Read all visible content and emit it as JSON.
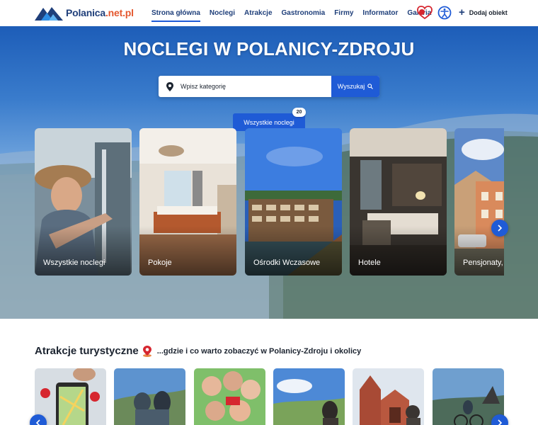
{
  "header": {
    "logo": {
      "name": "Polanica",
      "accent": ".net.pl",
      "icon": "mountain-logo-icon"
    },
    "nav": [
      {
        "label": "Strona główna",
        "active": true
      },
      {
        "label": "Noclegi",
        "active": false
      },
      {
        "label": "Atrakcje",
        "active": false
      },
      {
        "label": "Gastronomia",
        "active": false
      },
      {
        "label": "Firmy",
        "active": false
      },
      {
        "label": "Informator",
        "active": false
      },
      {
        "label": "Galeria",
        "active": false
      }
    ],
    "favorites_icon": "heart-icon",
    "accessibility_icon": "accessibility-icon",
    "add_label": "Dodaj obiekt"
  },
  "hero": {
    "title": "NOCLEGI W POLANICY-ZDROJU",
    "search": {
      "placeholder": "Wpisz kategorię",
      "button": "Wyszukaj"
    },
    "all_button": "Wszystkie noclegi",
    "count": "20"
  },
  "categories": [
    {
      "label": "Wszystkie noclegi"
    },
    {
      "label": "Pokoje"
    },
    {
      "label": "Ośrodki Wczasowe"
    },
    {
      "label": "Hotele"
    },
    {
      "label": "Pensjonaty,"
    }
  ],
  "attractions": {
    "title": "Atrakcje turystyczne",
    "subtitle": "...gdzie i co warto zobaczyć w Polanicy-Zdroju i okolicy"
  },
  "colors": {
    "primary": "#1f5bd6",
    "navy": "#1f3f7a",
    "accent": "#e4572e"
  }
}
